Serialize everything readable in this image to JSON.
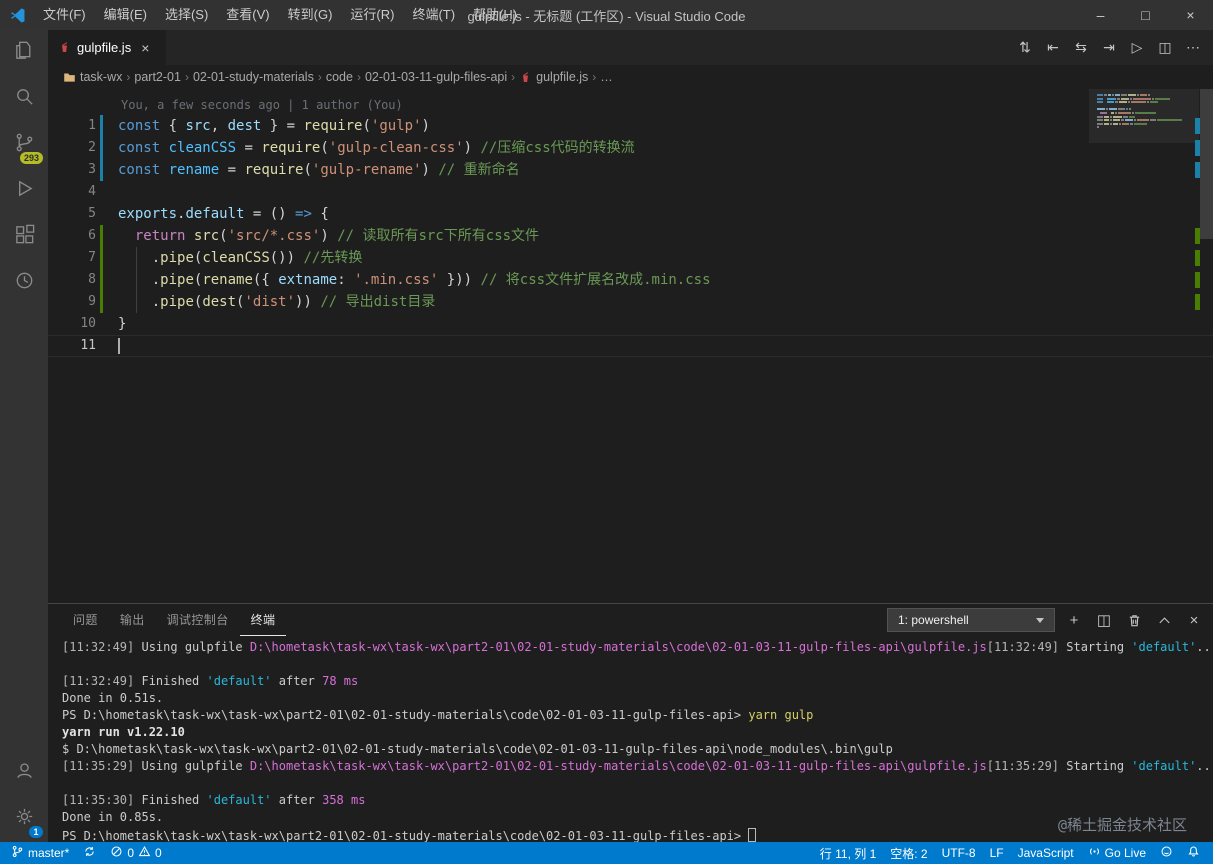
{
  "window": {
    "title": "gulpfile.js - 无标题 (工作区) - Visual Studio Code",
    "menus": [
      {
        "id": "file",
        "label": "文件(F)"
      },
      {
        "id": "edit",
        "label": "编辑(E)"
      },
      {
        "id": "selection",
        "label": "选择(S)"
      },
      {
        "id": "view",
        "label": "查看(V)"
      },
      {
        "id": "go",
        "label": "转到(G)"
      },
      {
        "id": "run",
        "label": "运行(R)"
      },
      {
        "id": "terminal",
        "label": "终端(T)"
      },
      {
        "id": "help",
        "label": "帮助(H)"
      }
    ],
    "controls": {
      "minimize": "–",
      "maximize": "□",
      "close": "×"
    }
  },
  "activity_bar": {
    "scm_badge": "293",
    "settings_badge": "1"
  },
  "editor": {
    "tab": {
      "label": "gulpfile.js",
      "close": "×"
    },
    "action_icons": [
      {
        "name": "compare-changes-icon",
        "glyph": "⇅"
      },
      {
        "name": "previous-change-icon",
        "glyph": "⇤"
      },
      {
        "name": "open-changes-icon",
        "glyph": "⇆"
      },
      {
        "name": "next-change-icon",
        "glyph": "⇥"
      },
      {
        "name": "run-file-icon",
        "glyph": "▷"
      },
      {
        "name": "split-editor-icon",
        "glyph": "◫"
      },
      {
        "name": "more-actions-icon",
        "glyph": "⋯"
      }
    ],
    "breadcrumb": [
      {
        "label": "task-wx",
        "icon": "folder"
      },
      {
        "label": "part2-01"
      },
      {
        "label": "02-01-study-materials"
      },
      {
        "label": "code"
      },
      {
        "label": "02-01-03-11-gulp-files-api"
      },
      {
        "label": "gulpfile.js",
        "icon": "gulp"
      },
      {
        "label": "…"
      }
    ],
    "annotation": "You, a few seconds ago | 1 author (You)",
    "lines": [
      {
        "n": 1,
        "gutter": "modified",
        "tokens": [
          {
            "c": "kw",
            "t": "const"
          },
          {
            "c": "pl",
            "t": " { "
          },
          {
            "c": "var",
            "t": "src"
          },
          {
            "c": "pl",
            "t": ", "
          },
          {
            "c": "var",
            "t": "dest"
          },
          {
            "c": "pl",
            "t": " } = "
          },
          {
            "c": "fn",
            "t": "require"
          },
          {
            "c": "pl",
            "t": "("
          },
          {
            "c": "str",
            "t": "'gulp'"
          },
          {
            "c": "pl",
            "t": ")"
          }
        ]
      },
      {
        "n": 2,
        "gutter": "modified",
        "tokens": [
          {
            "c": "kw",
            "t": "const"
          },
          {
            "c": "pl",
            "t": " "
          },
          {
            "c": "cvar",
            "t": "cleanCSS"
          },
          {
            "c": "pl",
            "t": " = "
          },
          {
            "c": "fn",
            "t": "require"
          },
          {
            "c": "pl",
            "t": "("
          },
          {
            "c": "str",
            "t": "'gulp-clean-css'"
          },
          {
            "c": "pl",
            "t": ") "
          },
          {
            "c": "cm",
            "t": "//压缩css代码的转换流"
          }
        ]
      },
      {
        "n": 3,
        "gutter": "modified",
        "tokens": [
          {
            "c": "kw",
            "t": "const"
          },
          {
            "c": "pl",
            "t": " "
          },
          {
            "c": "cvar",
            "t": "rename"
          },
          {
            "c": "pl",
            "t": " = "
          },
          {
            "c": "fn",
            "t": "require"
          },
          {
            "c": "pl",
            "t": "("
          },
          {
            "c": "str",
            "t": "'gulp-rename'"
          },
          {
            "c": "pl",
            "t": ") "
          },
          {
            "c": "cm",
            "t": "// 重新命名"
          }
        ]
      },
      {
        "n": 4,
        "tokens": []
      },
      {
        "n": 5,
        "tokens": [
          {
            "c": "var",
            "t": "exports"
          },
          {
            "c": "pl",
            "t": "."
          },
          {
            "c": "var",
            "t": "default"
          },
          {
            "c": "pl",
            "t": " = () "
          },
          {
            "c": "kw",
            "t": "=>"
          },
          {
            "c": "pl",
            "t": " {"
          }
        ]
      },
      {
        "n": 6,
        "gutter": "added",
        "tokens": [
          {
            "c": "pl",
            "t": "  "
          },
          {
            "c": "ctrl",
            "t": "return"
          },
          {
            "c": "pl",
            "t": " "
          },
          {
            "c": "fn",
            "t": "src"
          },
          {
            "c": "pl",
            "t": "("
          },
          {
            "c": "str",
            "t": "'src/*.css'"
          },
          {
            "c": "pl",
            "t": ") "
          },
          {
            "c": "cm",
            "t": "// 读取所有src下所有css文件"
          }
        ]
      },
      {
        "n": 7,
        "gutter": "added",
        "guide": true,
        "tokens": [
          {
            "c": "pl",
            "t": "    ."
          },
          {
            "c": "fn",
            "t": "pipe"
          },
          {
            "c": "pl",
            "t": "("
          },
          {
            "c": "fn",
            "t": "cleanCSS"
          },
          {
            "c": "pl",
            "t": "()) "
          },
          {
            "c": "cm",
            "t": "//先转换"
          }
        ]
      },
      {
        "n": 8,
        "gutter": "added",
        "guide": true,
        "tokens": [
          {
            "c": "pl",
            "t": "    ."
          },
          {
            "c": "fn",
            "t": "pipe"
          },
          {
            "c": "pl",
            "t": "("
          },
          {
            "c": "fn",
            "t": "rename"
          },
          {
            "c": "pl",
            "t": "({ "
          },
          {
            "c": "var",
            "t": "extname"
          },
          {
            "c": "pl",
            "t": ": "
          },
          {
            "c": "str",
            "t": "'.min.css'"
          },
          {
            "c": "pl",
            "t": " })) "
          },
          {
            "c": "cm",
            "t": "// 将css文件扩展名改成.min.css"
          }
        ]
      },
      {
        "n": 9,
        "gutter": "added",
        "guide": true,
        "tokens": [
          {
            "c": "pl",
            "t": "    ."
          },
          {
            "c": "fn",
            "t": "pipe"
          },
          {
            "c": "pl",
            "t": "("
          },
          {
            "c": "fn",
            "t": "dest"
          },
          {
            "c": "pl",
            "t": "("
          },
          {
            "c": "str",
            "t": "'dist'"
          },
          {
            "c": "pl",
            "t": ")) "
          },
          {
            "c": "cm",
            "t": "// 导出dist目录"
          }
        ]
      },
      {
        "n": 10,
        "tokens": [
          {
            "c": "pl",
            "t": "}"
          }
        ]
      },
      {
        "n": 11,
        "current": true,
        "cursor": true,
        "tokens": []
      }
    ]
  },
  "panel": {
    "tabs": [
      {
        "id": "problems",
        "label": "问题"
      },
      {
        "id": "output",
        "label": "输出"
      },
      {
        "id": "debug-console",
        "label": "调试控制台"
      },
      {
        "id": "terminal",
        "label": "终端",
        "active": true
      }
    ],
    "terminal_selector": "1: powershell",
    "controls": {
      "new": "+",
      "split": "◫",
      "close": "×"
    },
    "watermark": "@稀土掘金技术社区",
    "terminal_lines": [
      [
        {
          "c": "dim",
          "t": "[11:32:49]"
        },
        {
          "c": "t",
          "t": " Using gulpfile "
        },
        {
          "c": "path",
          "t": "D:\\hometask\\task-wx\\task-wx\\part2-01\\02-01-study-materials\\code\\02-01-03-11-gulp-files-api\\gulpfile.js"
        },
        {
          "c": "dim",
          "t": "[11:32:49]"
        },
        {
          "c": "t",
          "t": " Starting "
        },
        {
          "c": "cyan",
          "t": "'default'"
        },
        {
          "c": "t",
          "t": "..."
        }
      ],
      [],
      [
        {
          "c": "dim",
          "t": "[11:32:49]"
        },
        {
          "c": "t",
          "t": " Finished "
        },
        {
          "c": "cyan",
          "t": "'default'"
        },
        {
          "c": "t",
          "t": " after "
        },
        {
          "c": "mag",
          "t": "78 ms"
        }
      ],
      [
        {
          "c": "t",
          "t": "Done in 0.51s."
        }
      ],
      [
        {
          "c": "t",
          "t": "PS D:\\hometask\\task-wx\\task-wx\\part2-01\\02-01-study-materials\\code\\02-01-03-11-gulp-files-api> "
        },
        {
          "c": "yel",
          "t": "yarn gulp"
        }
      ],
      [
        {
          "c": "bold",
          "t": "yarn run v1.22.10"
        }
      ],
      [
        {
          "c": "t",
          "t": "$ D:\\hometask\\task-wx\\task-wx\\part2-01\\02-01-study-materials\\code\\02-01-03-11-gulp-files-api\\node_modules\\.bin\\gulp"
        }
      ],
      [
        {
          "c": "dim",
          "t": "[11:35:29]"
        },
        {
          "c": "t",
          "t": " Using gulpfile "
        },
        {
          "c": "path",
          "t": "D:\\hometask\\task-wx\\task-wx\\part2-01\\02-01-study-materials\\code\\02-01-03-11-gulp-files-api\\gulpfile.js"
        },
        {
          "c": "dim",
          "t": "[11:35:29]"
        },
        {
          "c": "t",
          "t": " Starting "
        },
        {
          "c": "cyan",
          "t": "'default'"
        },
        {
          "c": "t",
          "t": "..."
        }
      ],
      [],
      [
        {
          "c": "dim",
          "t": "[11:35:30]"
        },
        {
          "c": "t",
          "t": " Finished "
        },
        {
          "c": "cyan",
          "t": "'default'"
        },
        {
          "c": "t",
          "t": " after "
        },
        {
          "c": "mag",
          "t": "358 ms"
        }
      ],
      [
        {
          "c": "t",
          "t": "Done in 0.85s."
        }
      ],
      [
        {
          "c": "t",
          "t": "PS D:\\hometask\\task-wx\\task-wx\\part2-01\\02-01-study-materials\\code\\02-01-03-11-gulp-files-api> "
        },
        {
          "c": "cursor",
          "t": ""
        }
      ]
    ]
  },
  "status_bar": {
    "branch": "master*",
    "errors": "0",
    "warnings": "0",
    "cursor_position": "行 11, 列 1",
    "indent": "空格: 2",
    "encoding": "UTF-8",
    "eol": "LF",
    "language": "JavaScript",
    "go_live": "Go Live"
  },
  "colors": {
    "status_bar_bg": "#007acc",
    "titlebar_bg": "#323233",
    "activitybar_bg": "#333333",
    "editor_bg": "#1e1e1e",
    "tabbar_bg": "#252526",
    "scm_badge_bg": "#b5bd25",
    "settings_badge_bg": "#007acc",
    "keyword": "#569cd6",
    "control_keyword": "#c586c0",
    "variable": "#9cdcfe",
    "function": "#dcdcaa",
    "string": "#ce9178",
    "comment": "#6a9955",
    "git_modified": "#1b81a8",
    "git_added": "#487e02",
    "terminal_magenta": "#d670d6",
    "terminal_cyan": "#29b8db"
  }
}
